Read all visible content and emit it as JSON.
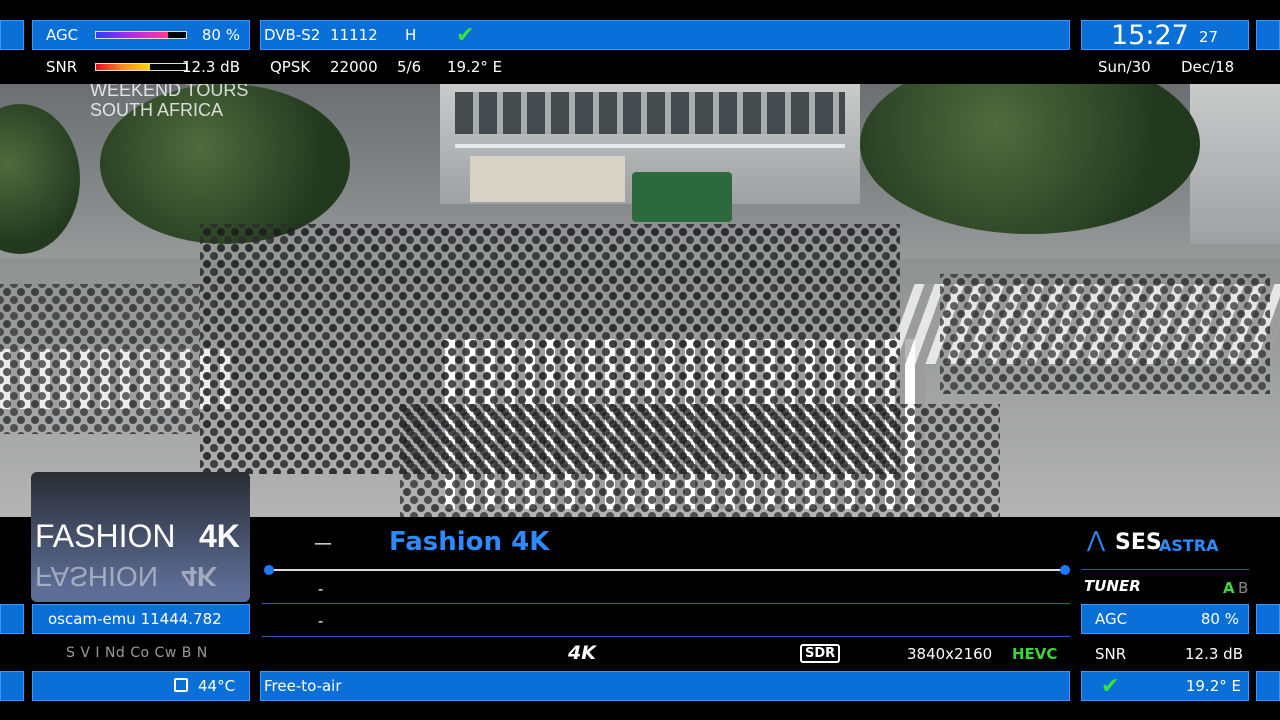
{
  "signal": {
    "agc_label": "AGC",
    "agc_value": "80 %",
    "agc_level": 0.8,
    "snr_label": "SNR",
    "snr_value": "12.3 dB",
    "snr_level": 0.6
  },
  "transponder": {
    "system": "DVB-S2",
    "frequency": "11112",
    "polarization": "H",
    "modulation": "QPSK",
    "symbol_rate": "22000",
    "fec": "5/6",
    "position": "19.2° E"
  },
  "clock": {
    "time": "15:27",
    "seconds": "27",
    "day": "Sun/30",
    "month_year": "Dec/18"
  },
  "video_overlay": {
    "line1": "WEEKEND TOURS",
    "line2": "SOUTH AFRICA"
  },
  "channel": {
    "logo_text": "FASHION",
    "logo_suffix": "4K",
    "dash": "—",
    "name": "Fashion 4K",
    "epg_now": "-",
    "epg_next": "-"
  },
  "cam": {
    "emu": "oscam-emu 11444.782",
    "systems": "S V I Nd Co Cw B N"
  },
  "temperature": "44°C",
  "encryption": "Free-to-air",
  "format": {
    "resolution_badge": "4K",
    "dynamic_range": "SDR",
    "video_size": "3840x2160",
    "codec": "HEVC"
  },
  "provider": {
    "brand_main": "SES",
    "brand_sub": "ASTRA"
  },
  "tuner": {
    "label": "TUNER",
    "tuner_a": "A",
    "tuner_b": "B",
    "agc_label": "AGC",
    "agc_value": "80 %",
    "snr_label": "SNR",
    "snr_value": "12.3 dB",
    "position": "19.2° E"
  },
  "colors": {
    "accent_blue": "#0a6fd6",
    "active_green": "#3fd43f",
    "channel_name": "#2e8bff"
  }
}
